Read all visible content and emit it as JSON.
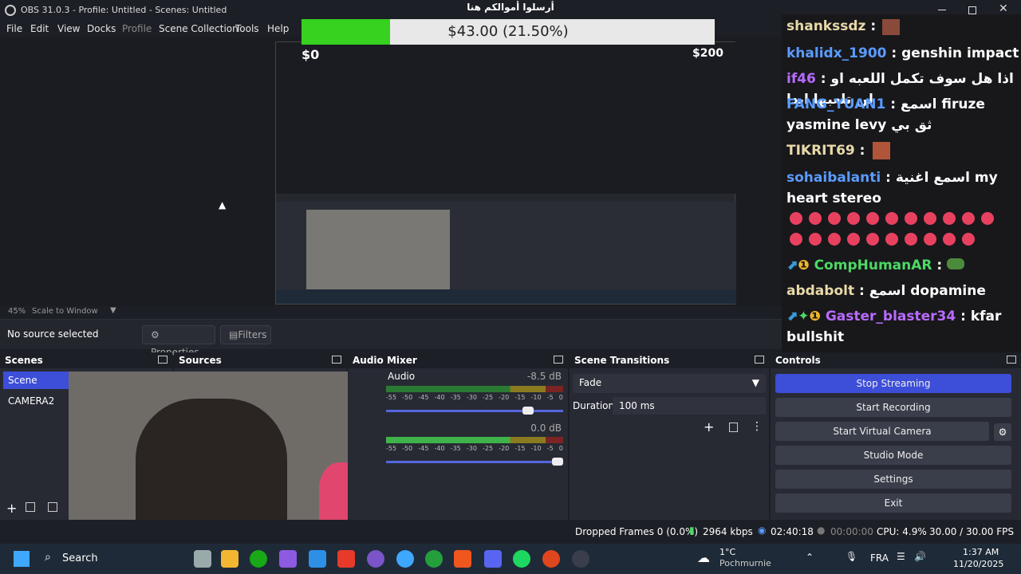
{
  "window": {
    "title": "OBS 31.0.3 - Profile: Untitled - Scenes: Untitled"
  },
  "menu": {
    "items": [
      "File",
      "Edit",
      "View",
      "Docks",
      "Profile",
      "Scene Collection",
      "Tools",
      "Help"
    ]
  },
  "donation": {
    "title": "أرسلوا أموالكم هنا",
    "amount": "$43.00 (21.50%)",
    "progress": 0.215,
    "start": "$0",
    "goal": "$200"
  },
  "preview": {
    "zoom": "45%",
    "scale": "Scale to Window"
  },
  "sourcebar": {
    "status": "No source selected",
    "properties": "Properties",
    "filters": "Filters"
  },
  "scenes": {
    "header": "Scenes",
    "items": [
      "Scene",
      "CAMERA2"
    ]
  },
  "sources": {
    "header": "Sources"
  },
  "mixer": {
    "header": "Audio Mixer",
    "channels": [
      {
        "name": "Audio",
        "db": "-8.5 dB",
        "volume": 0.82
      },
      {
        "name": "",
        "db": "0.0 dB",
        "volume": 1.0
      }
    ],
    "ticks": [
      "-55",
      "-50",
      "-45",
      "-40",
      "-35",
      "-30",
      "-25",
      "-20",
      "-15",
      "-10",
      "-5",
      "0"
    ]
  },
  "transitions": {
    "header": "Scene Transitions",
    "selected": "Fade",
    "duration_label": "Duration",
    "duration": "100 ms"
  },
  "controls": {
    "header": "Controls",
    "buttons": [
      "Stop Streaming",
      "Start Recording",
      "Start Virtual Camera",
      "Studio Mode",
      "Settings",
      "Exit"
    ],
    "accent": "#3d4ed8"
  },
  "status": {
    "dropped": "Dropped Frames 0 (0.0%)",
    "bitrate": "2964 kbps",
    "stream_time": "02:40:18",
    "rec_time": "00:00:00",
    "cpu": "CPU: 4.9%",
    "fps": "30.00 / 30.00 FPS"
  },
  "chat": [
    {
      "user": "shankssdz",
      "color": "#e8d9a8",
      "msg": ""
    },
    {
      "user": "khalidx_1900",
      "color": "#5b9bff",
      "msg": "genshin impact"
    },
    {
      "user": "if46",
      "color": "#b86bff",
      "msg": "اذا هل سوف تكمل اللعبه او لن تلعبها ابدا"
    },
    {
      "user": "FANG_YUAN1",
      "color": "#5b9bff",
      "msg": "اسمع firuze yasmine levy ثق بي"
    },
    {
      "user": "TIKRIT69",
      "color": "#e8d9a8",
      "msg": ""
    },
    {
      "user": "sohaibalanti",
      "color": "#5b9bff",
      "msg": "اسمع اغنية my heart stereo"
    },
    {
      "user": "CompHumanAR",
      "color": "#4cd964",
      "msg": ""
    },
    {
      "user": "abdabolt",
      "color": "#e8d9a8",
      "msg": "اسمع dopamine"
    },
    {
      "user": "Gaster_blaster34",
      "color": "#b86bff",
      "msg": "kfar bullshit"
    }
  ],
  "taskbar": {
    "search": "Search",
    "weather_temp": "1°C",
    "weather_place": "Pochmurnie",
    "lang": "FRA",
    "time": "1:37 AM",
    "date": "11/20/2025"
  }
}
